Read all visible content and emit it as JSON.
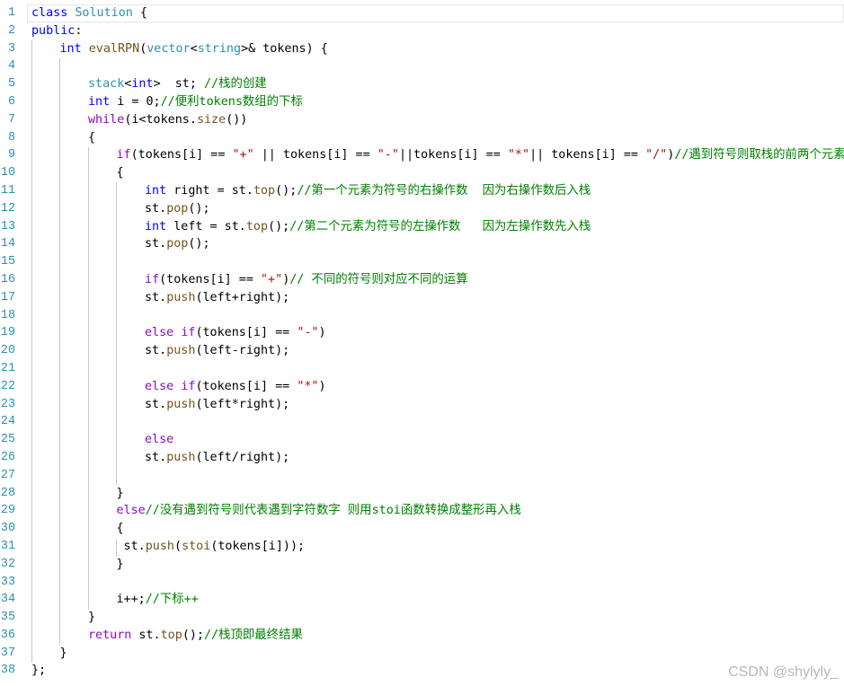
{
  "watermark": "CSDN @shylyly_",
  "lines": [
    {
      "n": "1",
      "indent": 0,
      "current": true,
      "tokens": [
        [
          "kw",
          "class"
        ],
        [
          "pu",
          " "
        ],
        [
          "ty",
          "Solution"
        ],
        [
          "pu",
          " {"
        ]
      ]
    },
    {
      "n": "2",
      "indent": 0,
      "tokens": [
        [
          "kw",
          "public"
        ],
        [
          "pu",
          ":"
        ]
      ]
    },
    {
      "n": "3",
      "indent": 1,
      "tokens": [
        [
          "kw",
          "int"
        ],
        [
          "pu",
          " "
        ],
        [
          "fn",
          "evalRPN"
        ],
        [
          "pu",
          "("
        ],
        [
          "ty",
          "vector"
        ],
        [
          "pu",
          "<"
        ],
        [
          "ty",
          "string"
        ],
        [
          "pu",
          ">& tokens) {"
        ]
      ]
    },
    {
      "n": "4",
      "indent": 0,
      "tokens": []
    },
    {
      "n": "5",
      "indent": 2,
      "tokens": [
        [
          "ty",
          "stack"
        ],
        [
          "pu",
          "<"
        ],
        [
          "kw",
          "int"
        ],
        [
          "pu",
          ">  st; "
        ],
        [
          "cm",
          "//栈的创建"
        ]
      ]
    },
    {
      "n": "6",
      "indent": 2,
      "tokens": [
        [
          "kw",
          "int"
        ],
        [
          "pu",
          " i = 0;"
        ],
        [
          "cm",
          "//便利tokens数组的下标"
        ]
      ]
    },
    {
      "n": "7",
      "indent": 2,
      "tokens": [
        [
          "pp",
          "while"
        ],
        [
          "pu",
          "(i<tokens."
        ],
        [
          "fn",
          "size"
        ],
        [
          "pu",
          "())"
        ]
      ]
    },
    {
      "n": "8",
      "indent": 2,
      "tokens": [
        [
          "pu",
          "{"
        ]
      ]
    },
    {
      "n": "9",
      "indent": 3,
      "tokens": [
        [
          "pp",
          "if"
        ],
        [
          "pu",
          "(tokens[i] == "
        ],
        [
          "str",
          "\"+\""
        ],
        [
          "pu",
          " || tokens[i] == "
        ],
        [
          "str",
          "\"-\""
        ],
        [
          "pu",
          "||tokens[i] == "
        ],
        [
          "str",
          "\"*\""
        ],
        [
          "pu",
          "|| tokens[i] == "
        ],
        [
          "str",
          "\"/\""
        ],
        [
          "pu",
          ")"
        ],
        [
          "cm",
          "//遇到符号则取栈的前两个元素"
        ]
      ]
    },
    {
      "n": "10",
      "indent": 3,
      "tokens": [
        [
          "pu",
          "{"
        ]
      ]
    },
    {
      "n": "11",
      "indent": 4,
      "tokens": [
        [
          "kw",
          "int"
        ],
        [
          "pu",
          " right = st."
        ],
        [
          "fn",
          "top"
        ],
        [
          "pu",
          "();"
        ],
        [
          "cm",
          "//第一个元素为符号的右操作数  因为右操作数后入栈"
        ]
      ]
    },
    {
      "n": "12",
      "indent": 4,
      "tokens": [
        [
          "pu",
          "st."
        ],
        [
          "fn",
          "pop"
        ],
        [
          "pu",
          "();"
        ]
      ]
    },
    {
      "n": "13",
      "indent": 4,
      "tokens": [
        [
          "kw",
          "int"
        ],
        [
          "pu",
          " left = st."
        ],
        [
          "fn",
          "top"
        ],
        [
          "pu",
          "();"
        ],
        [
          "cm",
          "//第二个元素为符号的左操作数   因为左操作数先入栈"
        ]
      ]
    },
    {
      "n": "14",
      "indent": 4,
      "tokens": [
        [
          "pu",
          "st."
        ],
        [
          "fn",
          "pop"
        ],
        [
          "pu",
          "();"
        ]
      ]
    },
    {
      "n": "15",
      "indent": 0,
      "tokens": []
    },
    {
      "n": "16",
      "indent": 4,
      "tokens": [
        [
          "pp",
          "if"
        ],
        [
          "pu",
          "(tokens[i] == "
        ],
        [
          "str",
          "\"+\""
        ],
        [
          "pu",
          ")"
        ],
        [
          "cm",
          "// 不同的符号则对应不同的运算"
        ]
      ]
    },
    {
      "n": "17",
      "indent": 4,
      "tokens": [
        [
          "pu",
          "st."
        ],
        [
          "fn",
          "push"
        ],
        [
          "pu",
          "(left+right);"
        ]
      ]
    },
    {
      "n": "18",
      "indent": 0,
      "tokens": []
    },
    {
      "n": "19",
      "indent": 4,
      "tokens": [
        [
          "pp",
          "else"
        ],
        [
          "pu",
          " "
        ],
        [
          "pp",
          "if"
        ],
        [
          "pu",
          "(tokens[i] == "
        ],
        [
          "str",
          "\"-\""
        ],
        [
          "pu",
          ")"
        ]
      ]
    },
    {
      "n": "20",
      "indent": 4,
      "tokens": [
        [
          "pu",
          "st."
        ],
        [
          "fn",
          "push"
        ],
        [
          "pu",
          "(left-right);"
        ]
      ]
    },
    {
      "n": "21",
      "indent": 0,
      "tokens": []
    },
    {
      "n": "22",
      "indent": 4,
      "tokens": [
        [
          "pp",
          "else"
        ],
        [
          "pu",
          " "
        ],
        [
          "pp",
          "if"
        ],
        [
          "pu",
          "(tokens[i] == "
        ],
        [
          "str",
          "\"*\""
        ],
        [
          "pu",
          ")"
        ]
      ]
    },
    {
      "n": "23",
      "indent": 4,
      "tokens": [
        [
          "pu",
          "st."
        ],
        [
          "fn",
          "push"
        ],
        [
          "pu",
          "(left*right);"
        ]
      ]
    },
    {
      "n": "24",
      "indent": 0,
      "tokens": []
    },
    {
      "n": "25",
      "indent": 4,
      "tokens": [
        [
          "pp",
          "else"
        ]
      ]
    },
    {
      "n": "26",
      "indent": 4,
      "tokens": [
        [
          "pu",
          "st."
        ],
        [
          "fn",
          "push"
        ],
        [
          "pu",
          "(left/right);"
        ]
      ]
    },
    {
      "n": "27",
      "indent": 0,
      "tokens": []
    },
    {
      "n": "28",
      "indent": 3,
      "tokens": [
        [
          "pu",
          "}"
        ]
      ]
    },
    {
      "n": "29",
      "indent": 3,
      "tokens": [
        [
          "pp",
          "else"
        ],
        [
          "cm",
          "//没有遇到符号则代表遇到字符数字 则用stoi函数转换成整形再入栈"
        ]
      ]
    },
    {
      "n": "30",
      "indent": 3,
      "tokens": [
        [
          "pu",
          "{"
        ]
      ]
    },
    {
      "n": "31",
      "indent": 3,
      "tokens": [
        [
          "pu",
          " st."
        ],
        [
          "fn",
          "push"
        ],
        [
          "pu",
          "("
        ],
        [
          "fn",
          "stoi"
        ],
        [
          "pu",
          "(tokens[i]));"
        ]
      ]
    },
    {
      "n": "32",
      "indent": 3,
      "tokens": [
        [
          "pu",
          "}"
        ]
      ]
    },
    {
      "n": "33",
      "indent": 0,
      "tokens": []
    },
    {
      "n": "34",
      "indent": 3,
      "tokens": [
        [
          "pu",
          "i++;"
        ],
        [
          "cm",
          "//下标++"
        ]
      ]
    },
    {
      "n": "35",
      "indent": 2,
      "tokens": [
        [
          "pu",
          "}"
        ]
      ]
    },
    {
      "n": "36",
      "indent": 2,
      "tokens": [
        [
          "pp",
          "return"
        ],
        [
          "pu",
          " st."
        ],
        [
          "fn",
          "top"
        ],
        [
          "pu",
          "();"
        ],
        [
          "cm",
          "//栈顶即最终结果"
        ]
      ]
    },
    {
      "n": "37",
      "indent": 1,
      "tokens": [
        [
          "pu",
          "}"
        ]
      ]
    },
    {
      "n": "38",
      "indent": 0,
      "tokens": [
        [
          "pu",
          "};"
        ]
      ]
    }
  ]
}
